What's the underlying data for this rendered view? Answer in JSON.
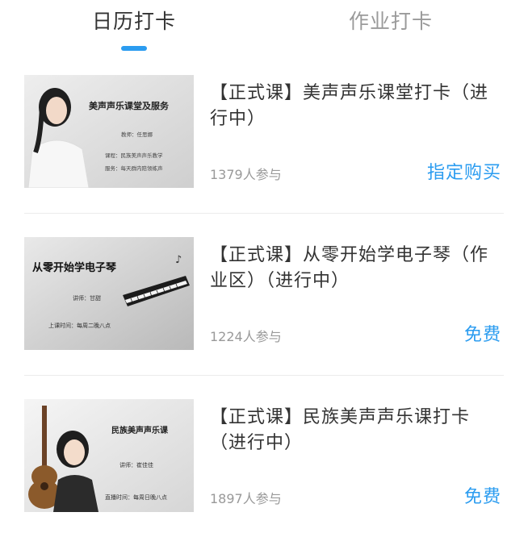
{
  "tabs": [
    {
      "label": "日历打卡",
      "active": true
    },
    {
      "label": "作业打卡",
      "active": false
    }
  ],
  "courses": [
    {
      "title": "【正式课】美声声乐课堂打卡（进行中）",
      "participants": "1379人参与",
      "price_label": "指定购买",
      "thumbnail": {
        "heading": "美声声乐课堂及服务",
        "line1": "教师：任思娜",
        "line2": "课程：民族美声声乐教学",
        "line3": "服务：每天群内陪领练声"
      }
    },
    {
      "title": "【正式课】从零开始学电子琴（作业区）（进行中）",
      "participants": "1224人参与",
      "price_label": "免费",
      "thumbnail": {
        "heading": "从零开始学电子琴",
        "line1": "讲师：甘甜",
        "line2": "上课时间：每周二晚八点"
      }
    },
    {
      "title": "【正式课】民族美声声乐课打卡（进行中）",
      "participants": "1897人参与",
      "price_label": "免费",
      "thumbnail": {
        "heading": "民族美声声乐课",
        "line1": "讲师：崔佳佳",
        "line2": "直播时间：每周日晚八点"
      }
    }
  ],
  "colors": {
    "accent": "#2b9cf0",
    "title_text": "#333333",
    "muted_text": "#999999"
  }
}
